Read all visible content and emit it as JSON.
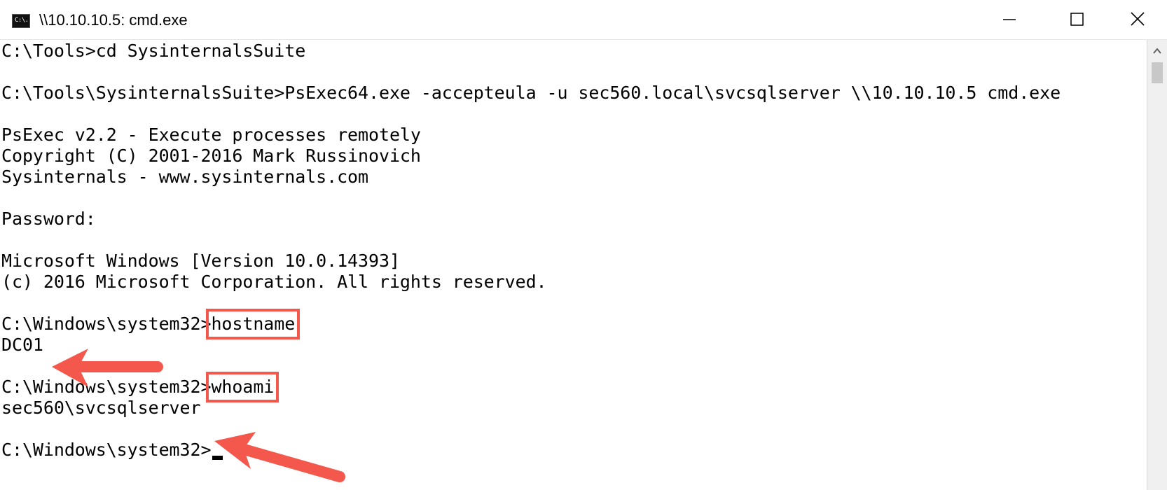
{
  "window": {
    "title": "\\\\10.10.10.5: cmd.exe",
    "icon_text": "C:\\."
  },
  "terminal": {
    "lines": [
      "C:\\Tools>cd SysinternalsSuite",
      "",
      "C:\\Tools\\SysinternalsSuite>PsExec64.exe -accepteula -u sec560.local\\svcsqlserver \\\\10.10.10.5 cmd.exe",
      "",
      "PsExec v2.2 - Execute processes remotely",
      "Copyright (C) 2001-2016 Mark Russinovich",
      "Sysinternals - www.sysinternals.com",
      "",
      "Password:",
      "",
      "Microsoft Windows [Version 10.0.14393]",
      "(c) 2016 Microsoft Corporation. All rights reserved.",
      "",
      "",
      "DC01",
      "",
      "",
      "sec560\\svcsqlserver",
      "",
      ""
    ],
    "hostname_prompt": "C:\\Windows\\system32>",
    "hostname_cmd": "hostname",
    "whoami_prompt": "C:\\Windows\\system32>",
    "whoami_cmd": "whoami",
    "final_prompt": "C:\\Windows\\system32>"
  },
  "colors": {
    "highlight": "#f4574c",
    "terminal_bg": "#ffffff",
    "terminal_fg": "#000000"
  },
  "icons": {
    "minimize": "minimize-icon",
    "maximize": "maximize-icon",
    "close": "close-icon",
    "scroll_up": "scroll-up-arrow-icon"
  }
}
